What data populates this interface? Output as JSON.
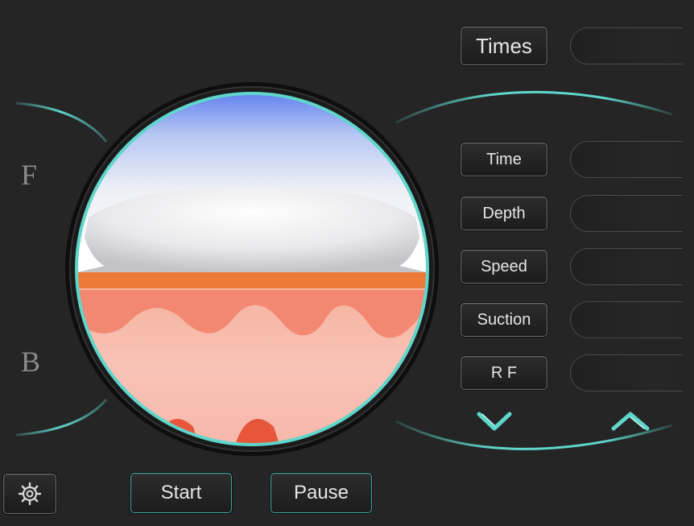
{
  "sidebar": {
    "front_label": "F",
    "back_label": "B"
  },
  "parameters": {
    "times": {
      "label": "Times",
      "value": ""
    },
    "time": {
      "label": "Time",
      "value": ""
    },
    "depth": {
      "label": "Depth",
      "value": ""
    },
    "speed": {
      "label": "Speed",
      "value": ""
    },
    "suction": {
      "label": "Suction",
      "value": ""
    },
    "rf": {
      "label": "R F",
      "value": ""
    }
  },
  "controls": {
    "start_label": "Start",
    "pause_label": "Pause",
    "decrease_icon": "chevron-down-icon",
    "increase_icon": "chevron-up-icon",
    "settings_icon": "gear-icon"
  },
  "colors": {
    "background": "#252525",
    "accent_teal": "#5fd6cc",
    "button_text": "#e6e6e6",
    "skin_layer": "#ee7a3a",
    "skin_pink": "#f7a99a"
  }
}
